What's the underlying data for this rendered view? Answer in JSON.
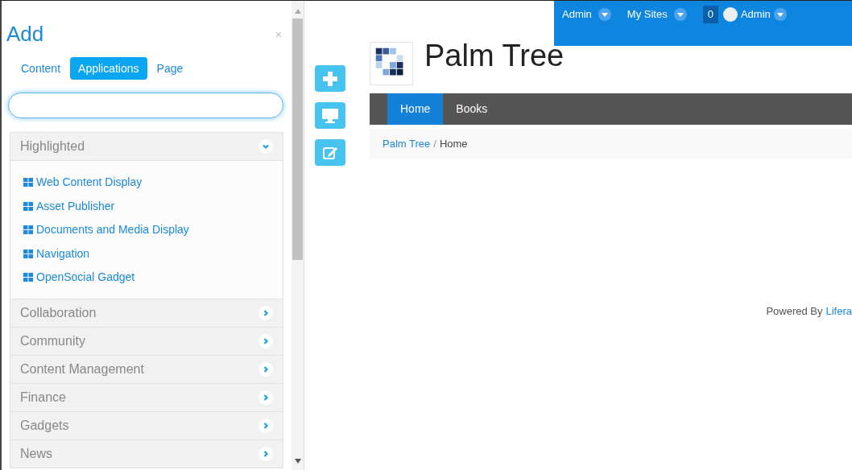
{
  "add_panel": {
    "title": "Add",
    "close": "×",
    "tabs": [
      {
        "label": "Content",
        "selected": false
      },
      {
        "label": "Applications",
        "selected": true
      },
      {
        "label": "Page",
        "selected": false
      }
    ],
    "categories": [
      {
        "label": "Highlighted",
        "expanded": true,
        "items": [
          "Web Content Display",
          "Asset Publisher",
          "Documents and Media Display",
          "Navigation",
          "OpenSocial Gadget"
        ]
      },
      {
        "label": "Collaboration",
        "expanded": false
      },
      {
        "label": "Community",
        "expanded": false
      },
      {
        "label": "Content Management",
        "expanded": false
      },
      {
        "label": "Finance",
        "expanded": false
      },
      {
        "label": "Gadgets",
        "expanded": false
      },
      {
        "label": "News",
        "expanded": false
      }
    ]
  },
  "dock": {
    "items": [
      {
        "label": "Admin",
        "kind": "menu"
      },
      {
        "label": "My Sites",
        "kind": "menu"
      },
      {
        "label": "0",
        "kind": "count"
      },
      {
        "label": "Admin",
        "kind": "user"
      }
    ]
  },
  "site": {
    "name": "Palm Tree",
    "nav": [
      {
        "label": "Home",
        "selected": true
      },
      {
        "label": "Books",
        "selected": false
      }
    ],
    "breadcrumb": {
      "link": "Palm Tree",
      "separator": "/",
      "current": "Home"
    },
    "footer": {
      "text": "Powered By",
      "link": "Lifera"
    }
  }
}
